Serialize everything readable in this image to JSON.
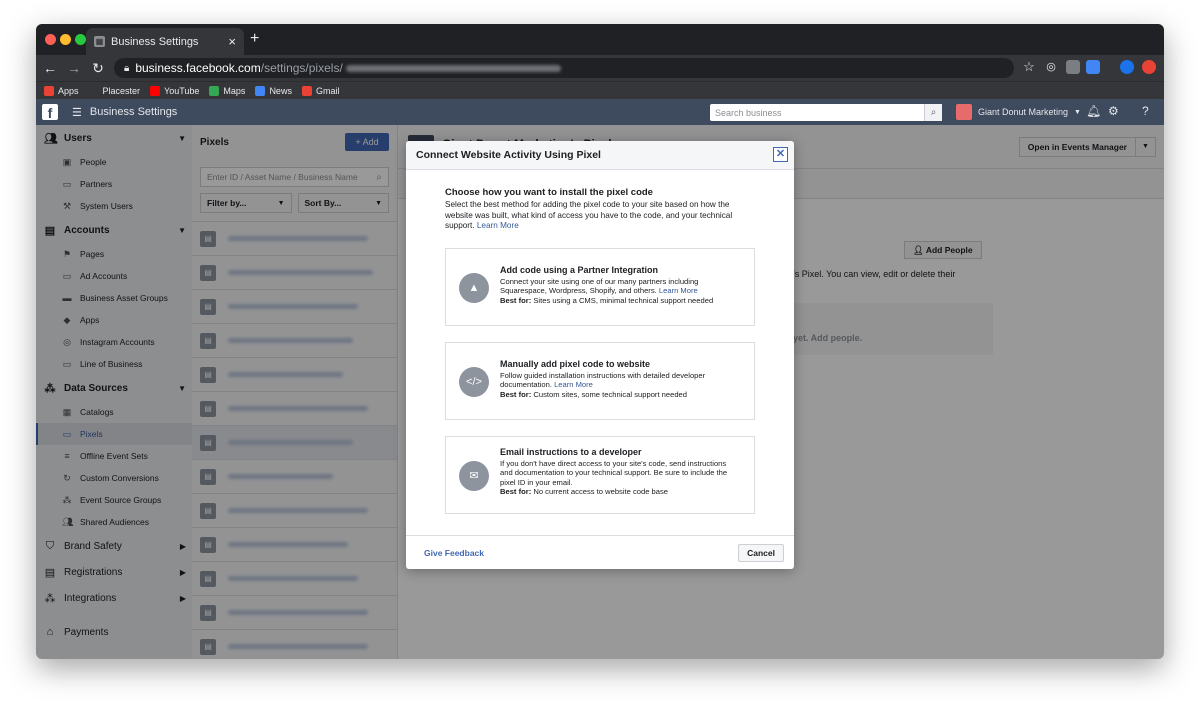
{
  "browser": {
    "tab_title": "Business Settings",
    "new_tab": "+",
    "url_host": "business.facebook.com",
    "url_path": "/settings/pixels/",
    "bookmarks": [
      {
        "label": "Apps",
        "color": "#ea4335"
      },
      {
        "label": "Placester",
        "color": "#35363a"
      },
      {
        "label": "YouTube",
        "color": "#ff0000"
      },
      {
        "label": "Maps",
        "color": "#34a853"
      },
      {
        "label": "News",
        "color": "#4285f4"
      },
      {
        "label": "Gmail",
        "color": "#ea4335"
      }
    ]
  },
  "fb": {
    "title": "Business Settings",
    "search_placeholder": "Search business",
    "account_name": "Giant Donut Marketing"
  },
  "sidebar": {
    "users_label": "Users",
    "people": "People",
    "partners": "Partners",
    "system_users": "System Users",
    "accounts_label": "Accounts",
    "pages": "Pages",
    "ad_accounts": "Ad Accounts",
    "business_asset_groups": "Business Asset Groups",
    "apps": "Apps",
    "instagram_accounts": "Instagram Accounts",
    "line_of_business": "Line of Business",
    "data_sources_label": "Data Sources",
    "catalogs": "Catalogs",
    "pixels": "Pixels",
    "offline_event_sets": "Offline Event Sets",
    "custom_conversions": "Custom Conversions",
    "event_source_groups": "Event Source Groups",
    "shared_audiences": "Shared Audiences",
    "brand_safety": "Brand Safety",
    "registrations": "Registrations",
    "integrations": "Integrations",
    "payments": "Payments"
  },
  "pixels_panel": {
    "header": "Pixels",
    "add_label": "+ Add",
    "search_placeholder": "Enter ID / Asset Name / Business Name",
    "filter_label": "Filter by...",
    "sort_label": "Sort By..."
  },
  "detail": {
    "title": "Giant Donut Marketing's Pixel",
    "open_button": "Open in Events Manager",
    "add_people": "Add People",
    "partial_text": "'s Pixel. You can view, edit or delete their",
    "empty_text": "yet. Add people."
  },
  "modal": {
    "title": "Connect Website Activity Using Pixel",
    "close": "✕",
    "heading": "Choose how you want to install the pixel code",
    "intro": "Select the best method for adding the pixel code to your site based on how the website was built, what kind of access you have to the code, and your technical support.",
    "learn_more": "Learn More",
    "best_for_label": "Best for:",
    "options": [
      {
        "title": "Add code using a Partner Integration",
        "desc": "Connect your site using one of our many partners including Squarespace, Wordpress, Shopify, and others.",
        "link": "Learn More",
        "best_for": "Sites using a CMS, minimal technical support needed"
      },
      {
        "title": "Manually add pixel code to website",
        "desc": "Follow guided installation instructions with detailed developer documentation.",
        "link": "Learn More",
        "best_for": "Custom sites, some technical support needed"
      },
      {
        "title": "Email instructions to a developer",
        "desc": "If you don't have direct access to your site's code, send instructions and documentation to your technical support. Be sure to include the pixel ID in your email.",
        "link": "",
        "best_for": "No current access to website code base"
      }
    ],
    "feedback": "Give Feedback",
    "cancel": "Cancel"
  }
}
